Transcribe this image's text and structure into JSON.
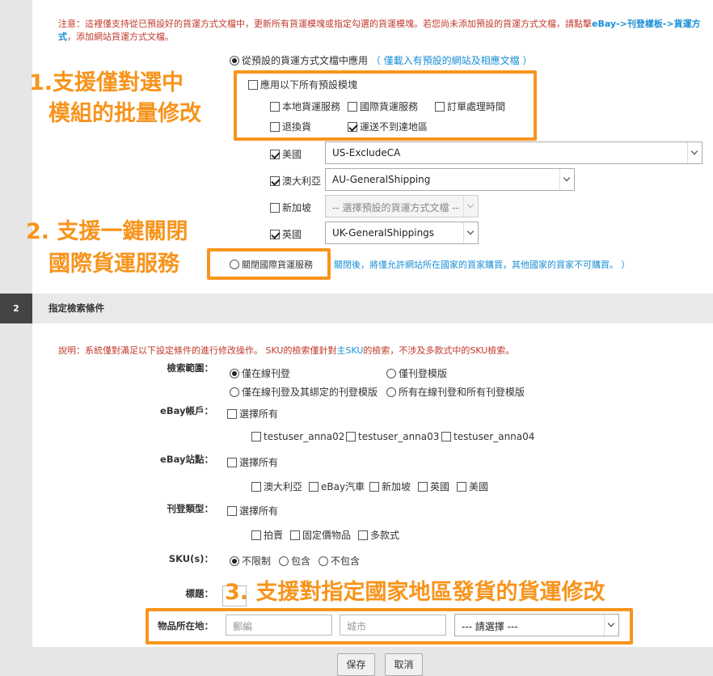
{
  "section1": {
    "notice_text": "注意：這裡僅支持從已預設好的貨運方式文檔中，更新所有貨運模塊或指定勾選的貨運模塊。若您尚未添加預設的貨運方式文檔，請點擊",
    "notice_link": "eBay->刊登樣板->貨運方式",
    "notice_tail": "，添加網站貨運方式文檔。",
    "apply_preset_label": "從預設的貨運方式文檔中應用",
    "apply_preset_hint": "（ 僅載入有預設的網站及相應文檔 ）",
    "apply_all_label": "應用以下所有預設模塊",
    "modules": [
      "本地貨運服務",
      "國際貨運服務",
      "訂單處理時間",
      "退換貨",
      "運送不到達地區"
    ],
    "sites": [
      {
        "name": "美國",
        "value": "US-ExcludeCA"
      },
      {
        "name": "澳大利亞",
        "value": "AU-GeneralShipping"
      },
      {
        "name": "新加坡",
        "value": "-- 選擇預設的貨運方式文檔 --"
      },
      {
        "name": "英國",
        "value": "UK-GeneralShippings"
      }
    ],
    "close_intl_label": "關閉國際貨運服務",
    "close_intl_hint": "關閉後，將僅允許網站所在國家的買家購買，其他國家的買家不可購買。 ）"
  },
  "annotations": {
    "a1_line1": "1.支援僅對選中",
    "a1_line2": "模組的批量修改",
    "a2_line1": "2. 支援一鍵關閉",
    "a2_line2": "國際貨運服務",
    "a3": "3. 支援對指定國家地區發貨的貨運修改"
  },
  "section2": {
    "number": "2",
    "title": "指定檢索條件",
    "notice_text": "說明：系統僅對滿足以下設定條件的進行修改操作。 SKU的檢索僅針對",
    "notice_blue": "主SKU",
    "notice_tail": "的檢索，不涉及多款式中的SKU檢索。",
    "scope_label": "檢索範圍：",
    "scope_options": [
      "僅在線刊登",
      "僅刊登模版",
      "僅在線刊登及其綁定的刊登模版",
      "所有在線刊登和所有刊登模版"
    ],
    "account_label": "eBay帳戶：",
    "select_all": "選擇所有",
    "accounts": [
      "testuser_anna02",
      "testuser_anna03",
      "testuser_anna04"
    ],
    "site_label": "eBay站點：",
    "site_options": [
      "澳大利亞",
      "eBay汽車",
      "新加坡",
      "英國",
      "美國"
    ],
    "type_label": "刊登類型：",
    "type_options": [
      "拍賣",
      "固定價物品",
      "多款式"
    ],
    "sku_label": "SKU(s)：",
    "sku_options": [
      "不限制",
      "包含",
      "不包含"
    ],
    "title_label": "標題：",
    "location_label": "物品所在地：",
    "postcode_placeholder": "郵編",
    "city_placeholder": "城市",
    "country_select": "--- 請選擇 ---"
  },
  "footer": {
    "save": "保存",
    "cancel": "取消"
  }
}
